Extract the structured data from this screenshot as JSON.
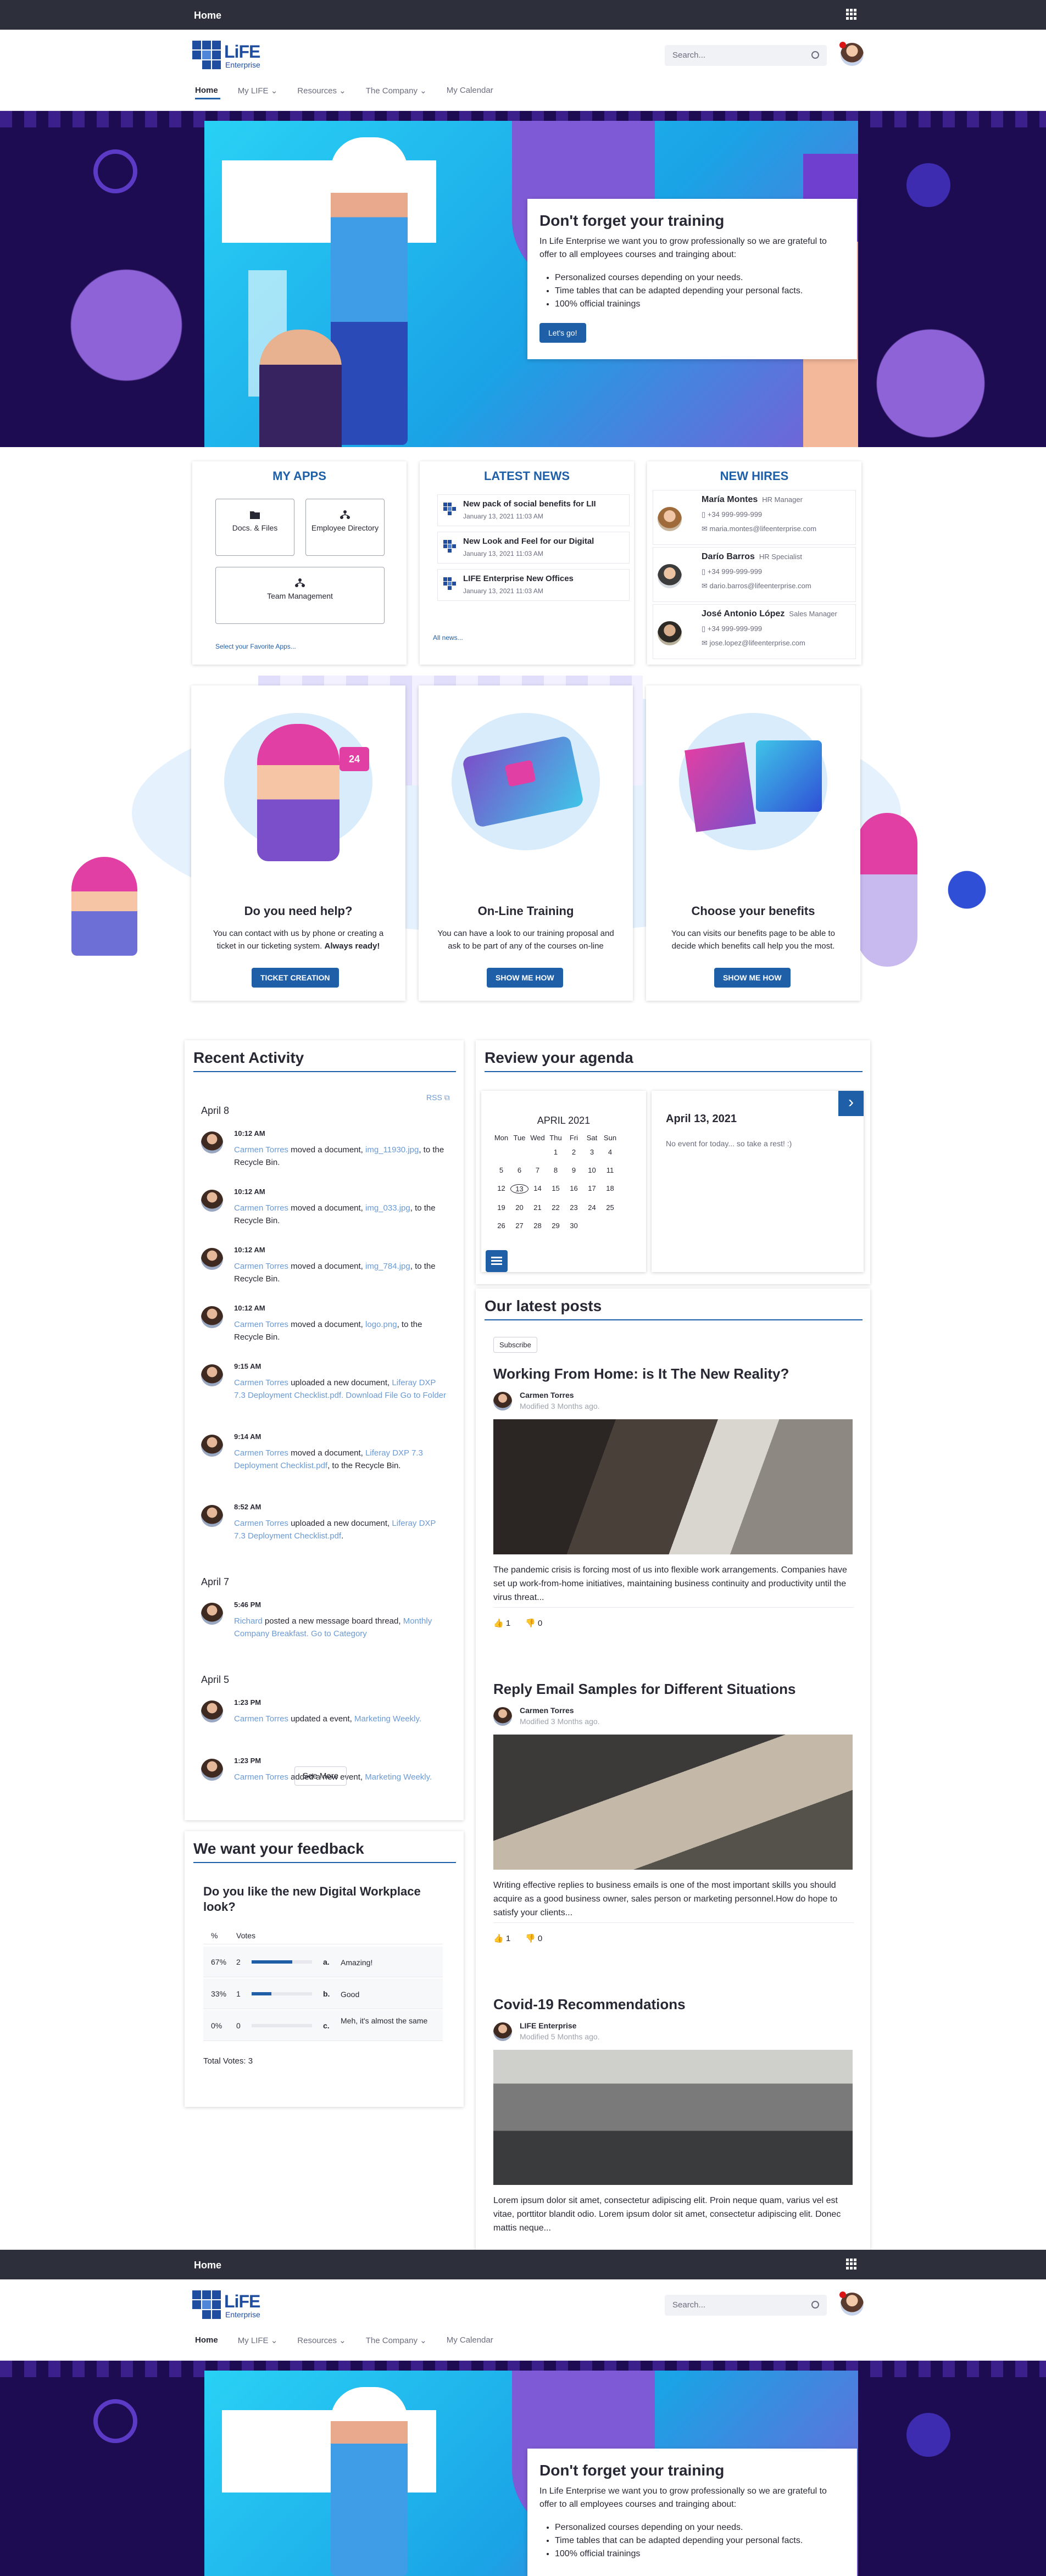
{
  "topbar": {
    "home": "Home"
  },
  "header": {
    "logo_word": "LiFE",
    "logo_sub": "Enterprise",
    "search_placeholder": "Search...",
    "nav": [
      "Home",
      "My LIFE",
      "Resources",
      "The Company",
      "My Calendar"
    ]
  },
  "hero": {
    "title": "Don't forget your training",
    "text": "In Life Enterprise we want you to grow professionally so we are grateful to offer to all employees courses and trainging about:",
    "bullets": [
      "Personalized courses depending on your needs.",
      "Time tables that can be adapted depending your personal facts.",
      "100% official trainings"
    ],
    "button": "Let's go!"
  },
  "my_apps": {
    "title": "MY APPS",
    "apps": [
      "Docs. & Files",
      "Employee Directory",
      "Team Management"
    ],
    "link": "Select your Favorite Apps..."
  },
  "latest_news": {
    "title": "LATEST NEWS",
    "items": [
      {
        "title": "New pack of social benefits for LII",
        "date": "January 13, 2021 11:03 AM"
      },
      {
        "title": "New Look and Feel for our Digital",
        "date": "January 13, 2021 11:03 AM"
      },
      {
        "title": "LIFE Enterprise New Offices",
        "date": "January 13, 2021 11:03 AM"
      }
    ],
    "link": "All news..."
  },
  "new_hires": {
    "title": "NEW HIRES",
    "people": [
      {
        "name": "María Montes",
        "role": "HR Manager",
        "phone": "+34 999-999-999",
        "email": "maria.montes@lifeenterprise.com"
      },
      {
        "name": "Darío Barros",
        "role": "HR Specialist",
        "phone": "+34 999-999-999",
        "email": "dario.barros@lifeenterprise.com"
      },
      {
        "name": "José Antonio López",
        "role": "Sales Manager",
        "phone": "+34 999-999-999",
        "email": "jose.lopez@lifeenterprise.com"
      }
    ]
  },
  "promos": [
    {
      "title": "Do you need help?",
      "text": "You can contact with us by phone or creating a ticket in our ticketing system.",
      "bold": "Always ready!",
      "button": "TICKET CREATION",
      "badge": "24"
    },
    {
      "title": "On-Line Training",
      "text": "You can have a look to our training proposal and ask to be part of any of the courses on-line",
      "bold": "",
      "button": "SHOW ME HOW",
      "badge": ""
    },
    {
      "title": "Choose your benefits",
      "text": "You can visits our benefits page to be able to decide which benefits call help you the most.",
      "bold": "",
      "button": "SHOW ME HOW",
      "badge": ""
    }
  ],
  "activity": {
    "title": "Recent Activity",
    "rss": "RSS",
    "more": "See More",
    "days": [
      {
        "label": "April 8",
        "items": [
          {
            "time": "10:12 AM",
            "user": "Carmen Torres",
            "action": "moved a document,",
            "link": "img_11930.jpg",
            "rest": ", to the Recycle Bin."
          },
          {
            "time": "10:12 AM",
            "user": "Carmen Torres",
            "action": "moved a document,",
            "link": "img_033.jpg",
            "rest": ", to the Recycle Bin."
          },
          {
            "time": "10:12 AM",
            "user": "Carmen Torres",
            "action": "moved a document,",
            "link": "img_784.jpg",
            "rest": ", to the Recycle Bin."
          },
          {
            "time": "10:12 AM",
            "user": "Carmen Torres",
            "action": "moved a document,",
            "link": "logo.png",
            "rest": ", to the Recycle Bin."
          },
          {
            "time": "9:15 AM",
            "user": "Carmen Torres",
            "action": "uploaded a new document,",
            "link": "Liferay DXP 7.3 Deployment Checklist.pdf. Download File Go to Folder",
            "rest": ""
          },
          {
            "time": "9:14 AM",
            "user": "Carmen Torres",
            "action": "moved a document,",
            "link": "Liferay DXP 7.3 Deployment Checklist.pdf",
            "rest": ", to the Recycle Bin."
          },
          {
            "time": "8:52 AM",
            "user": "Carmen Torres",
            "action": "uploaded a new document,",
            "link": "Liferay DXP 7.3 Deployment Checklist.pdf",
            "rest": "."
          }
        ]
      },
      {
        "label": "April 7",
        "items": [
          {
            "time": "5:46 PM",
            "user": "Richard",
            "action": "posted a new message board thread,",
            "link": "Monthly Company Breakfast. Go to Category",
            "rest": ""
          }
        ]
      },
      {
        "label": "April 5",
        "items": [
          {
            "time": "1:23 PM",
            "user": "Carmen Torres",
            "action": "updated a event,",
            "link": "Marketing Weekly.",
            "rest": ""
          },
          {
            "time": "1:23 PM",
            "user": "Carmen Torres",
            "action": "added a new event,",
            "link": "Marketing Weekly.",
            "rest": ""
          }
        ]
      }
    ]
  },
  "feedback": {
    "title": "We want your feedback",
    "question": "Do you like the new Digital Workplace look?",
    "col_pct": "%",
    "col_votes": "Votes",
    "rows": [
      {
        "pct": "67%",
        "votes": "2",
        "fill": 0.67,
        "letter": "a.",
        "answer": "Amazing!"
      },
      {
        "pct": "33%",
        "votes": "1",
        "fill": 0.33,
        "letter": "b.",
        "answer": "Good"
      },
      {
        "pct": "0%",
        "votes": "0",
        "fill": 0,
        "letter": "c.",
        "answer": "Meh, it's almost the same"
      }
    ],
    "total": "Total Votes: 3"
  },
  "agenda": {
    "title": "Review your agenda",
    "month": "APRIL 2021",
    "weekdays": [
      "Mon",
      "Tue",
      "Wed",
      "Thu",
      "Fri",
      "Sat",
      "Sun"
    ],
    "days": [
      "",
      "",
      "",
      "1",
      "2",
      "3",
      "4",
      "5",
      "6",
      "7",
      "8",
      "9",
      "10",
      "11",
      "12",
      "13",
      "14",
      "15",
      "16",
      "17",
      "18",
      "19",
      "20",
      "21",
      "22",
      "23",
      "24",
      "25",
      "26",
      "27",
      "28",
      "29",
      "30",
      "",
      ""
    ],
    "selected_date": "April 13, 2021",
    "no_event": "No event for today... so take a rest! :)"
  },
  "posts": {
    "title": "Our latest posts",
    "subscribe": "Subscribe",
    "items": [
      {
        "title": "Working From Home: is It The New Reality?",
        "author": "Carmen Torres",
        "modified": "Modified 3 Months ago.",
        "excerpt": "The pandemic crisis is forcing most of us into flexible work arrangements. Companies have set up work-from-home initiatives, maintaining business continuity and productivity until the virus threat...",
        "likes": "1",
        "dislikes": "0"
      },
      {
        "title": "Reply Email Samples for Different Situations",
        "author": "Carmen Torres",
        "modified": "Modified 3 Months ago.",
        "excerpt": "Writing effective replies to business emails is one of the most important skills you should acquire as a good business owner, sales person or marketing personnel.How do hope to satisfy your clients...",
        "likes": "1",
        "dislikes": "0"
      },
      {
        "title": "Covid-19 Recommendations",
        "author": "LIFE Enterprise",
        "modified": "Modified 5 Months ago.",
        "excerpt": "Lorem ipsum dolor sit amet, consectetur adipiscing elit. Proin neque quam, varius vel est vitae, porttitor blandit odio. Lorem ipsum dolor sit amet, consectetur adipiscing elit. Donec mattis neque...",
        "likes": "",
        "dislikes": ""
      }
    ]
  },
  "colors": {
    "brand": "#1f5fa8",
    "hero_bg": "#1e0c52",
    "topbar": "#2d2f3a"
  }
}
